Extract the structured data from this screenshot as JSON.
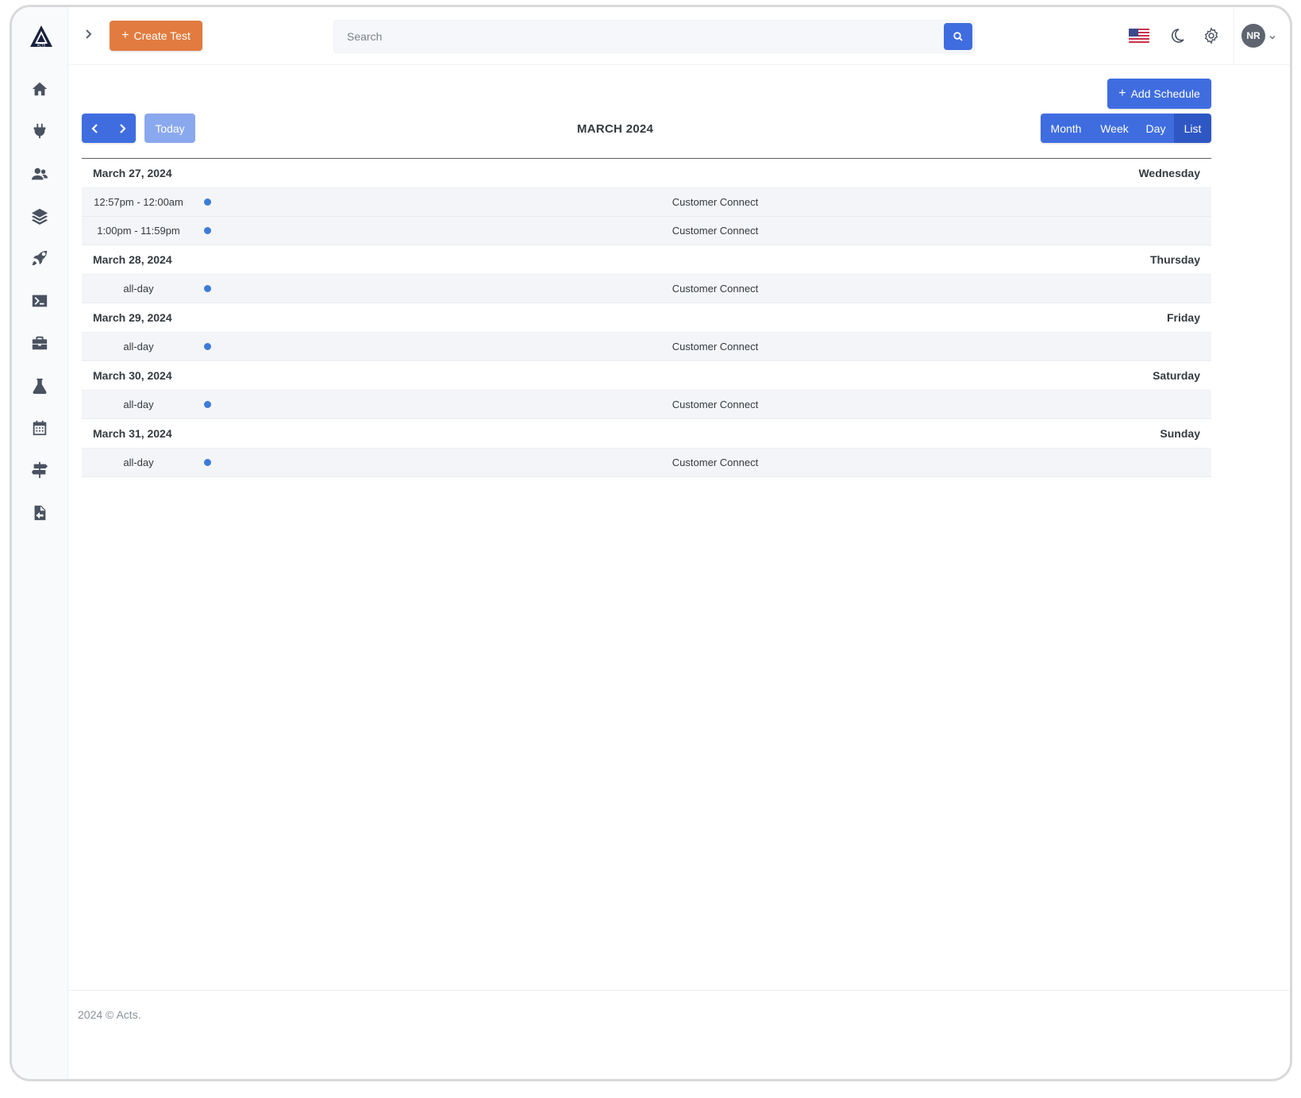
{
  "app": {
    "logo_text": "ACTS"
  },
  "topbar": {
    "create_label": "Create Test",
    "search_placeholder": "Search",
    "avatar_initials": "NR"
  },
  "sidebar": {
    "items": [
      {
        "icon": "home-icon"
      },
      {
        "icon": "plug-icon"
      },
      {
        "icon": "users-icon"
      },
      {
        "icon": "layers-icon"
      },
      {
        "icon": "rocket-icon"
      },
      {
        "icon": "terminal-icon"
      },
      {
        "icon": "briefcase-icon"
      },
      {
        "icon": "flask-icon"
      },
      {
        "icon": "calendar-icon"
      },
      {
        "icon": "signpost-icon"
      },
      {
        "icon": "file-import-icon"
      }
    ]
  },
  "calendar": {
    "add_schedule_label": "Add Schedule",
    "today_label": "Today",
    "title": "MARCH 2024",
    "views": [
      "Month",
      "Week",
      "Day",
      "List"
    ],
    "active_view": "List",
    "days": [
      {
        "date": "March 27, 2024",
        "weekday": "Wednesday",
        "events": [
          {
            "time": "12:57pm - 12:00am",
            "title": "Customer Connect"
          },
          {
            "time": "1:00pm - 11:59pm",
            "title": "Customer Connect"
          }
        ]
      },
      {
        "date": "March 28, 2024",
        "weekday": "Thursday",
        "events": [
          {
            "time": "all-day",
            "title": "Customer Connect"
          }
        ]
      },
      {
        "date": "March 29, 2024",
        "weekday": "Friday",
        "events": [
          {
            "time": "all-day",
            "title": "Customer Connect"
          }
        ]
      },
      {
        "date": "March 30, 2024",
        "weekday": "Saturday",
        "events": [
          {
            "time": "all-day",
            "title": "Customer Connect"
          }
        ]
      },
      {
        "date": "March 31, 2024",
        "weekday": "Sunday",
        "events": [
          {
            "time": "all-day",
            "title": "Customer Connect"
          }
        ]
      }
    ]
  },
  "footer": {
    "text": "2024 © Acts."
  },
  "colors": {
    "primary": "#3f6de0",
    "accent": "#e27b3f",
    "event_dot": "#3d7bd9"
  }
}
